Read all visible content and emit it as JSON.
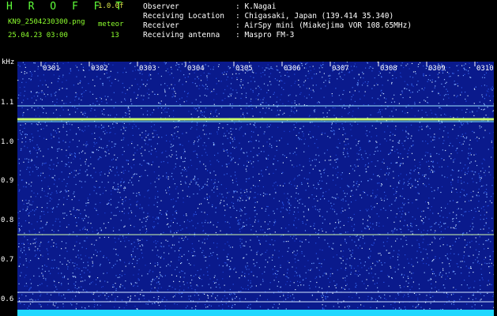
{
  "header": {
    "title": "H R O F F T",
    "version": "1.0.0f",
    "filename": "KN9_2504230300.png",
    "meteor_label": "meteor",
    "datetime": "25.04.23 03:00",
    "count": "13",
    "fields": [
      {
        "label": "Observer",
        "value": ": K.Nagai"
      },
      {
        "label": "Receiving Location",
        "value": ": Chigasaki, Japan (139.414 35.340)"
      },
      {
        "label": "Receiver",
        "value": ": AirSpy mini (Miakejima VOR 108.65MHz)"
      },
      {
        "label": "Receiving antenna",
        "value": ": Maspro FM-3"
      }
    ]
  },
  "plot": {
    "y_unit": "kHz",
    "y_ticks": [
      "1.1",
      "1.0",
      "0.9",
      "0.8",
      "0.7",
      "0.6"
    ],
    "x_ticks": [
      "0301",
      "0302",
      "0303",
      "0304",
      "0305",
      "0306",
      "0307",
      "0308",
      "0309",
      "0310"
    ],
    "colors": {
      "background": "#0a1a8c",
      "noise": "#1f46d8",
      "signal": "#c8ff6a",
      "baseline": "#20d8ff"
    }
  }
}
